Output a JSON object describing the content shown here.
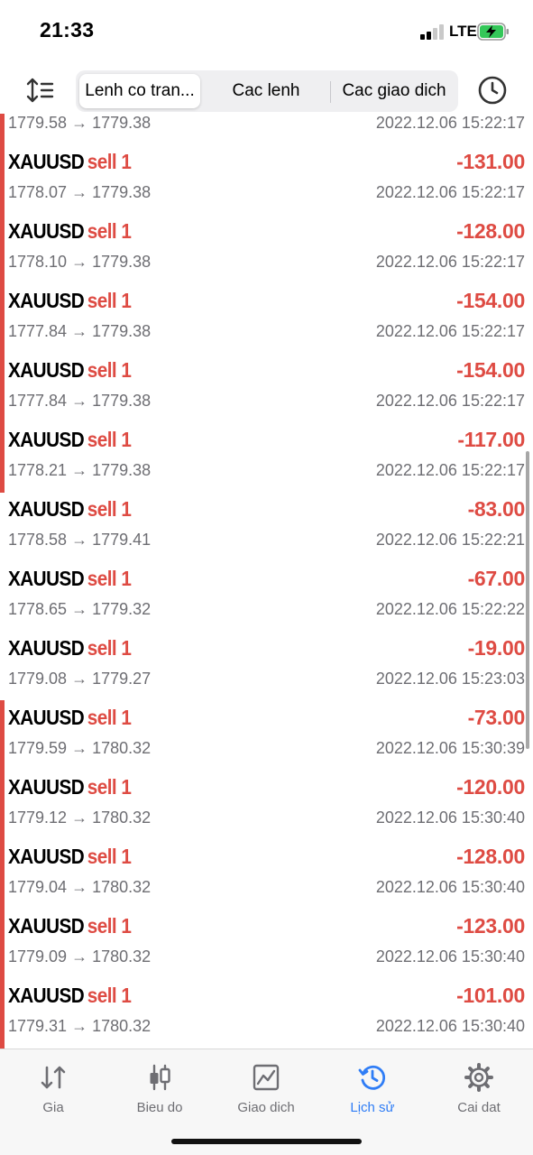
{
  "status": {
    "time": "21:33",
    "network": "LTE"
  },
  "toolbar": {
    "sort_icon": "sort-icon",
    "segments": [
      "Lenh co tran...",
      "Cac lenh",
      "Cac giao dich"
    ],
    "active_segment": 0,
    "clock_icon": "clock-icon"
  },
  "colors": {
    "loss": "#de4b43",
    "accent": "#2f7df6",
    "muted": "#6e6e73"
  },
  "list": {
    "top_partial": {
      "prices": "1779.58 → 1779.38",
      "time": "2022.12.06 15:22:17"
    },
    "rows": [
      {
        "symbol": "XAUUSD",
        "side": "sell 1",
        "profit": "-131.00",
        "prices": "1778.07 → 1779.38",
        "time": "2022.12.06 15:22:17"
      },
      {
        "symbol": "XAUUSD",
        "side": "sell 1",
        "profit": "-128.00",
        "prices": "1778.10 → 1779.38",
        "time": "2022.12.06 15:22:17"
      },
      {
        "symbol": "XAUUSD",
        "side": "sell 1",
        "profit": "-154.00",
        "prices": "1777.84 → 1779.38",
        "time": "2022.12.06 15:22:17"
      },
      {
        "symbol": "XAUUSD",
        "side": "sell 1",
        "profit": "-154.00",
        "prices": "1777.84 → 1779.38",
        "time": "2022.12.06 15:22:17"
      },
      {
        "symbol": "XAUUSD",
        "side": "sell 1",
        "profit": "-117.00",
        "prices": "1778.21 → 1779.38",
        "time": "2022.12.06 15:22:17"
      },
      {
        "symbol": "XAUUSD",
        "side": "sell 1",
        "profit": "-83.00",
        "prices": "1778.58 → 1779.41",
        "time": "2022.12.06 15:22:21"
      },
      {
        "symbol": "XAUUSD",
        "side": "sell 1",
        "profit": "-67.00",
        "prices": "1778.65 → 1779.32",
        "time": "2022.12.06 15:22:22"
      },
      {
        "symbol": "XAUUSD",
        "side": "sell 1",
        "profit": "-19.00",
        "prices": "1779.08 → 1779.27",
        "time": "2022.12.06 15:23:03"
      },
      {
        "symbol": "XAUUSD",
        "side": "sell 1",
        "profit": "-73.00",
        "prices": "1779.59 → 1780.32",
        "time": "2022.12.06 15:30:39"
      },
      {
        "symbol": "XAUUSD",
        "side": "sell 1",
        "profit": "-120.00",
        "prices": "1779.12 → 1780.32",
        "time": "2022.12.06 15:30:40"
      },
      {
        "symbol": "XAUUSD",
        "side": "sell 1",
        "profit": "-128.00",
        "prices": "1779.04 → 1780.32",
        "time": "2022.12.06 15:30:40"
      },
      {
        "symbol": "XAUUSD",
        "side": "sell 1",
        "profit": "-123.00",
        "prices": "1779.09 → 1780.32",
        "time": "2022.12.06 15:30:40"
      },
      {
        "symbol": "XAUUSD",
        "side": "sell 1",
        "profit": "-101.00",
        "prices": "1779.31 → 1780.32",
        "time": "2022.12.06 15:30:40"
      }
    ]
  },
  "tabs": [
    {
      "label": "Gia",
      "icon": "quotes-icon"
    },
    {
      "label": "Bieu do",
      "icon": "chart-candles-icon"
    },
    {
      "label": "Giao dich",
      "icon": "trade-chart-icon"
    },
    {
      "label": "Lịch sử",
      "icon": "history-icon"
    },
    {
      "label": "Cai dat",
      "icon": "settings-icon"
    }
  ],
  "active_tab": 3
}
